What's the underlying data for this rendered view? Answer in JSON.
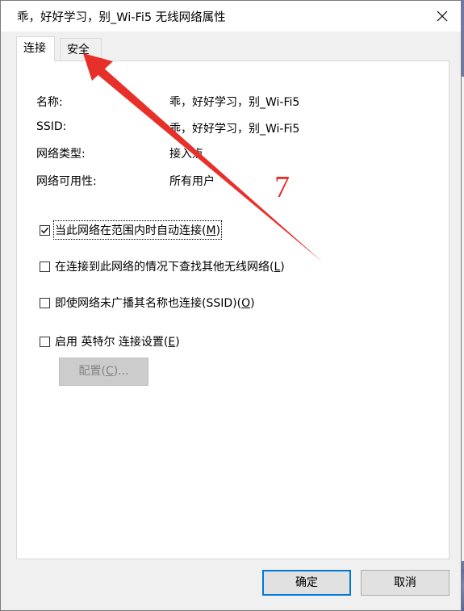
{
  "window": {
    "title": "乖，好好学习，别_Wi-Fi5 无线网络属性"
  },
  "tabs": [
    {
      "label": "连接"
    },
    {
      "label": "安全"
    }
  ],
  "properties": [
    {
      "label": "名称:",
      "value": "乖，好好学习，别_Wi-Fi5"
    },
    {
      "label": "SSID:",
      "value": "乖，好好学习，别_Wi-Fi5"
    },
    {
      "label": "网络类型:",
      "value": "接入点"
    },
    {
      "label": "网络可用性:",
      "value": "所有用户"
    }
  ],
  "options": [
    {
      "text": "当此网络在范围内时自动连接(",
      "key": "M",
      "end": ")",
      "checked": true
    },
    {
      "text": "在连接到此网络的情况下查找其他无线网络(",
      "key": "L",
      "end": ")",
      "checked": false
    },
    {
      "text": "即使网络未广播其名称也连接(SSID)(",
      "key": "O",
      "end": ")",
      "checked": false
    },
    {
      "text": "启用 英特尔 连接设置(",
      "key": "E",
      "end": ")",
      "checked": false
    }
  ],
  "config_button": {
    "text": "配置(",
    "key": "C",
    "end": ")..."
  },
  "buttons": {
    "ok": "确定",
    "cancel": "取消"
  },
  "annotation": {
    "number": "7",
    "color": "#e8302a"
  }
}
